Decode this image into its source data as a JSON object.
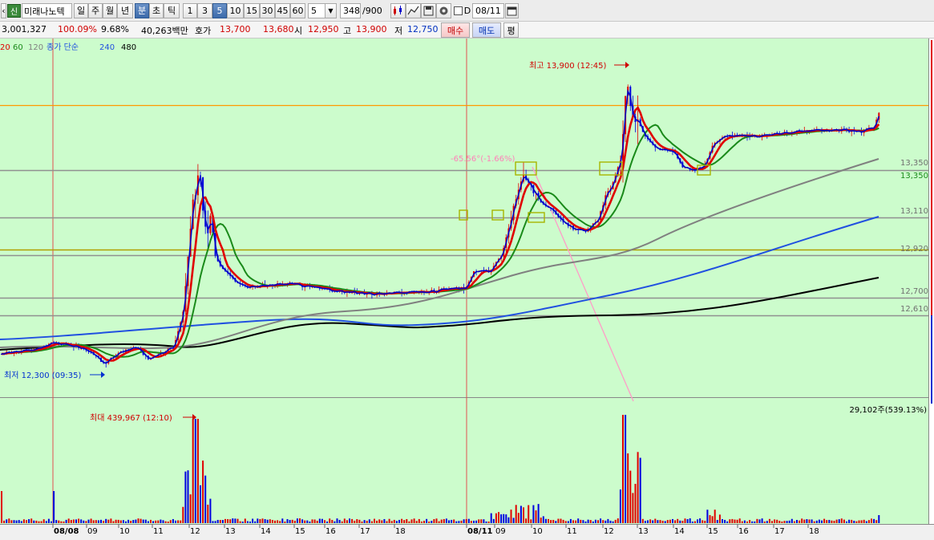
{
  "toolbar": {
    "stock_badge": "신",
    "stock_name": "미래나노텍",
    "periods": [
      "일",
      "주",
      "월",
      "년",
      "분",
      "초",
      "틱"
    ],
    "selected_period": "분",
    "intervals": [
      "1",
      "3",
      "5",
      "10",
      "15",
      "30",
      "45",
      "60"
    ],
    "selected_interval": "5",
    "interval_input": "5",
    "count_value": "348",
    "count_total": "/900",
    "date_checkbox_label": "D",
    "date_value": "08/11"
  },
  "info": {
    "volume": "3,001,327",
    "volume_ratio": "100.09%",
    "change_rate": "9.68%",
    "trade_value": "40,263백만",
    "quote_label": "호가",
    "ask": "13,700",
    "bid": "13,680",
    "open_label": "시",
    "open": "12,950",
    "high_label": "고",
    "high": "13,900",
    "low_label": "저",
    "low": "12,750",
    "buy_button": "매수",
    "sell_button": "매도",
    "eval_button": "평"
  },
  "legend": {
    "ma20": "20",
    "ma60": "60",
    "ma120": "120",
    "method": "종가 단순",
    "ma240": "240",
    "ma480": "480"
  },
  "annotations": {
    "high_marker": "최고 13,900 (12:45)",
    "low_marker": "최저 12,300 (09:35)",
    "angle": "-65.56°(-1.66%)",
    "volume_max": "최대 439,967 (12:10)",
    "volume_current": "29,102주(539.13%)"
  },
  "colors": {
    "background": "#ccfccc",
    "ma5": "#0000c8",
    "ma20": "#e00000",
    "ma60": "#1a8a1a",
    "ma120": "#808080",
    "ma240": "#2050e0",
    "ma480": "#000000",
    "up": "#e00000",
    "down": "#0000e0"
  },
  "chart_data": {
    "type": "candlestick",
    "price_axis_labels": [
      "13,350",
      "13,350",
      "13,110",
      "12,920",
      "12,700",
      "12,610"
    ],
    "horizontal_levels": [
      13900,
      13350,
      13110,
      12920,
      12880,
      12700,
      12610
    ],
    "x_axis_labels": [
      "08/08",
      "09",
      "10",
      "11",
      "12",
      "13",
      "14",
      "15",
      "16",
      "17",
      "18",
      "08/11",
      "09",
      "10",
      "11",
      "12",
      "13",
      "14",
      "15",
      "16",
      "17",
      "18"
    ],
    "sessions": [
      "08/08",
      "08/11"
    ],
    "price_range": [
      12300,
      13900
    ],
    "current_price": 13690,
    "max_volume": 439967,
    "current_volume": 29102
  }
}
